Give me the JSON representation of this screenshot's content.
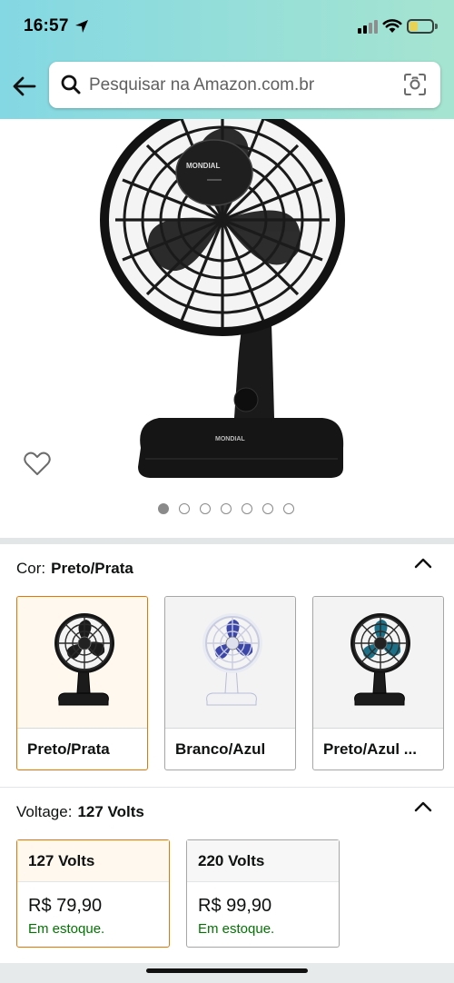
{
  "status_bar": {
    "time": "16:57",
    "battery_color": "#f4d03f"
  },
  "search": {
    "placeholder": "Pesquisar na Amazon.com.br"
  },
  "brand": "MONDIAL",
  "carousel": {
    "dot_count": 7,
    "active_index": 0
  },
  "color_section": {
    "label": "Cor:",
    "selected": "Preto/Prata",
    "options": [
      {
        "name": "Preto/Prata",
        "selected": true,
        "fan_color": "#1b1b1b",
        "blade_color": "#1b1b1b"
      },
      {
        "name": "Branco/Azul",
        "selected": false,
        "fan_color": "#f2f2f4",
        "blade_color": "#3b46a8"
      },
      {
        "name": "Preto/Azul ...",
        "selected": false,
        "fan_color": "#1b1b1b",
        "blade_color": "#1b6f86"
      }
    ]
  },
  "voltage_section": {
    "label": "Voltage:",
    "selected": "127 Volts",
    "options": [
      {
        "name": "127 Volts",
        "price": "R$ 79,90",
        "stock": "Em estoque.",
        "selected": true
      },
      {
        "name": "220 Volts",
        "price": "R$ 99,90",
        "stock": "Em estoque.",
        "selected": false
      }
    ]
  },
  "colors": {
    "accent_selected": "#e77600",
    "in_stock": "#007600"
  }
}
